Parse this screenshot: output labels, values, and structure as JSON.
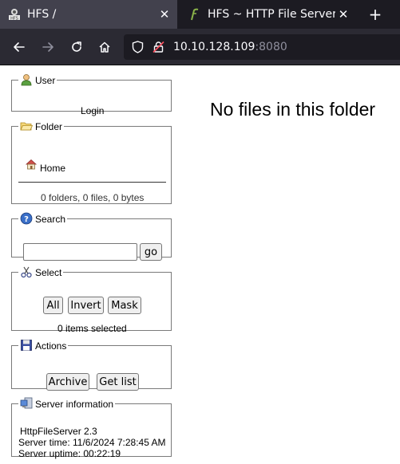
{
  "browser": {
    "tabs": [
      {
        "title": "HFS /",
        "active": true
      },
      {
        "title": "HFS ~ HTTP File Server",
        "active": false
      }
    ],
    "new_tab": "+",
    "url_host": "10.10.128.109",
    "url_port": ":8080"
  },
  "user": {
    "legend": "User",
    "login": "Login"
  },
  "folder": {
    "legend": "Folder",
    "home": "Home",
    "stats": "0 folders, 0 files, 0 bytes"
  },
  "search": {
    "legend": "Search",
    "go": "go",
    "value": ""
  },
  "select": {
    "legend": "Select",
    "all": "All",
    "invert": "Invert",
    "mask": "Mask",
    "status": "0 items selected"
  },
  "actions": {
    "legend": "Actions",
    "archive": "Archive",
    "get_list": "Get list"
  },
  "server": {
    "legend": "Server information",
    "version_link": "HttpFileServer 2.3",
    "time": "Server time: 11/6/2024 7:28:45 AM",
    "uptime": "Server uptime: 00:22:19"
  },
  "main": {
    "message": "No files in this folder"
  },
  "colors": {
    "tabbar": "#1c1b22",
    "active_tab": "#42414d",
    "navbar": "#2b2a33",
    "link": "#3b4fc4"
  }
}
